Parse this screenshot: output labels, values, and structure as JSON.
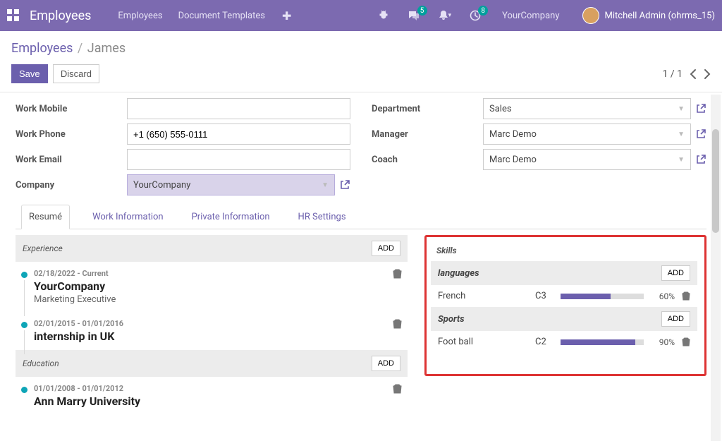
{
  "nav": {
    "title": "Employees",
    "links": [
      "Employees",
      "Document Templates"
    ],
    "company": "YourCompany",
    "user": "Mitchell Admin (ohrms_15)",
    "badges": {
      "chat": "5",
      "activities": "8"
    }
  },
  "breadcrumb": {
    "root": "Employees",
    "current": "James"
  },
  "actions": {
    "save": "Save",
    "discard": "Discard"
  },
  "pager": {
    "text": "1 / 1"
  },
  "form": {
    "left": {
      "work_mobile_label": "Work Mobile",
      "work_mobile_value": "",
      "work_phone_label": "Work Phone",
      "work_phone_value": "+1 (650) 555-0111",
      "work_email_label": "Work Email",
      "work_email_value": "",
      "company_label": "Company",
      "company_value": "YourCompany"
    },
    "right": {
      "department_label": "Department",
      "department_value": "Sales",
      "manager_label": "Manager",
      "manager_value": "Marc Demo",
      "coach_label": "Coach",
      "coach_value": "Marc Demo"
    }
  },
  "tabs": [
    "Resumé",
    "Work Information",
    "Private Information",
    "HR Settings"
  ],
  "resume": {
    "add_label": "ADD",
    "sections": [
      {
        "title": "Experience",
        "items": [
          {
            "dates": "02/18/2022 - Current",
            "title": "YourCompany",
            "sub": "Marketing Executive"
          },
          {
            "dates": "02/01/2015 - 01/01/2016",
            "title": "internship in UK",
            "sub": ""
          }
        ]
      },
      {
        "title": "Education",
        "items": [
          {
            "dates": "01/01/2008 - 01/01/2012",
            "title": "Ann Marry University",
            "sub": ""
          }
        ]
      }
    ]
  },
  "skills": {
    "title": "Skills",
    "add_label": "ADD",
    "groups": [
      {
        "label": "languages",
        "items": [
          {
            "name": "French",
            "level": "C3",
            "percent": 60,
            "pct_label": "60%"
          }
        ]
      },
      {
        "label": "Sports",
        "items": [
          {
            "name": "Foot ball",
            "level": "C2",
            "percent": 90,
            "pct_label": "90%"
          }
        ]
      }
    ]
  }
}
